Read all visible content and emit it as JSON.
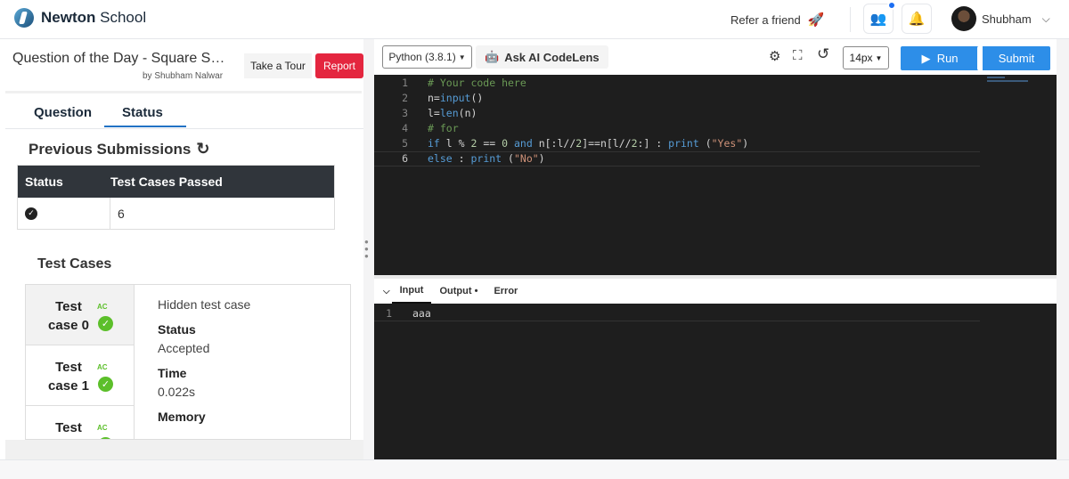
{
  "header": {
    "brand_bold": "Newton",
    "brand_rest": " School",
    "refer_label": "Refer a friend",
    "user_name": "Shubham"
  },
  "problem": {
    "title": "Question of the Day - Square S…",
    "author": "by Shubham Nalwar",
    "tour_label": "Take a Tour",
    "report_label": "Report"
  },
  "tabs": [
    {
      "label": "Question"
    },
    {
      "label": "Status"
    }
  ],
  "submissions": {
    "title": "Previous Submissions",
    "columns": [
      "Status",
      "Test Cases Passed"
    ],
    "rows": [
      {
        "passed": "6"
      }
    ]
  },
  "test_cases": {
    "title": "Test Cases",
    "items": [
      {
        "name": "Test case 0",
        "badge": "AC"
      },
      {
        "name": "Test case 1",
        "badge": "AC"
      },
      {
        "name": "Test",
        "badge": "AC"
      }
    ],
    "detail": {
      "type": "Hidden test case",
      "status_label": "Status",
      "status_value": "Accepted",
      "time_label": "Time",
      "time_value": "0.022s",
      "memory_label": "Memory"
    }
  },
  "editor_toolbar": {
    "language": "Python (3.8.1)",
    "ask_ai": "Ask AI CodeLens",
    "font_size": "14px",
    "run_label": "Run",
    "submit_label": "Submit"
  },
  "code_lines": [
    "# Your code here",
    "n=input()",
    "l=len(n)",
    "# for",
    "if l % 2 == 0 and n[:l//2]==n[l//2:] : print (\"Yes\")",
    "else : print (\"No\")"
  ],
  "io_tabs": [
    "Input",
    "Output •",
    "Error"
  ],
  "input_lines": [
    "aaa"
  ],
  "colors": {
    "accent": "#2d8ee8",
    "report": "#e4263f",
    "success": "#5cbf2a",
    "editor_bg": "#1e1e1e"
  }
}
